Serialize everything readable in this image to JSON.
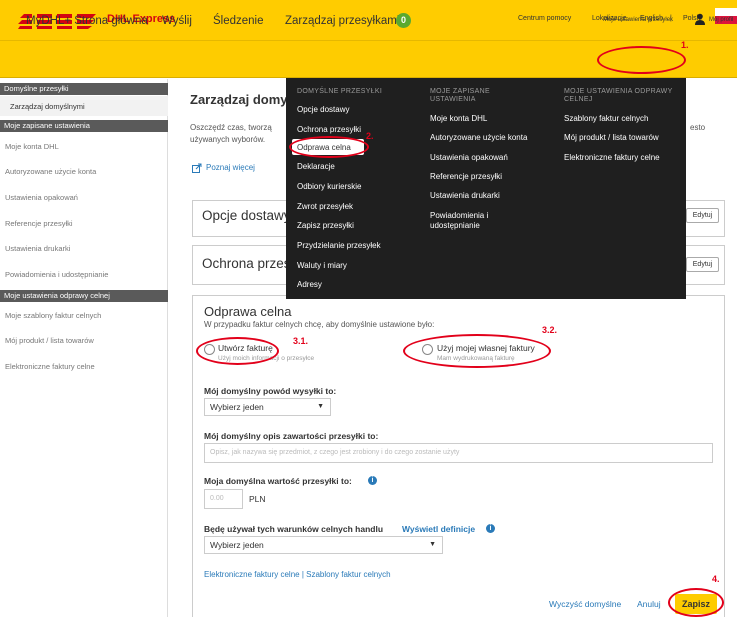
{
  "header": {
    "brand": "DHL Express",
    "links": [
      "Centrum pomocy",
      "Lokalizacje",
      "English",
      "|",
      "Polski"
    ]
  },
  "nav": {
    "items": [
      "MyDHL+ Strona główna",
      "Wyślij",
      "Śledzenie",
      "Zarządzaj przesyłkami"
    ],
    "badge": "0",
    "settings": "Moje ustawienia przesyłek",
    "profile": "Mój profil"
  },
  "sidebar": {
    "sections": [
      {
        "header": "Domyślne przesyłki",
        "items": [
          "Zarządzaj domyślnymi"
        ]
      },
      {
        "header": "Moje zapisane ustawienia",
        "items": [
          "Moje konta DHL",
          "Autoryzowane użycie konta",
          "Ustawienia opakowań",
          "Referencje przesyłki",
          "Ustawienia drukarki",
          "Powiadomienia i udostępnianie"
        ]
      },
      {
        "header": "Moje ustawienia odprawy celnej",
        "items": [
          "Moje szablony faktur celnych",
          "Mój produkt / lista towarów",
          "Elektroniczne faktury celne"
        ]
      }
    ]
  },
  "main": {
    "title": "Zarządzaj domyś",
    "description_line1": "Oszczędź czas, tworzą",
    "description_line1_end": "esto",
    "description_line2": "używanych wyborów.",
    "learn_more": "Poznaj więcej",
    "panels": [
      {
        "title": "Opcje dostawy",
        "edit": "Edytuj"
      },
      {
        "title": "Ochrona przes",
        "edit": "Edytuj"
      }
    ]
  },
  "customs": {
    "title": "Odprawa celna",
    "subtitle": "W przypadku faktur celnych chcę, aby domyślnie ustawione było:",
    "option1_label": "Utwórz fakturę",
    "option1_sub": "Użyj moich informacji o przesyłce",
    "option2_label": "Użyj mojej własnej faktury",
    "option2_sub": "Mam wydrukowaną fakturę",
    "reason_label": "Mój domyślny powód wysyłki to:",
    "reason_value": "Wybierz jeden",
    "desc_label": "Mój domyślny opis zawartości przesyłki to:",
    "desc_placeholder": "Opisz, jak nazywa się przedmiot, z czego jest zrobiony i do czego zostanie użyty",
    "value_label": "Moja domyślna wartość przesyłki to:",
    "value_placeholder": "0.00",
    "currency": "PLN",
    "terms_label": "Będę używał tych warunków celnych handlu",
    "terms_link": "Wyświetl definicje",
    "terms_value": "Wybierz jeden",
    "links_line": "Elektroniczne faktury celne | Szablony faktur celnych",
    "clear": "Wyczyść domyślne",
    "cancel": "Anuluj",
    "save": "Zapisz"
  },
  "mega_menu": {
    "col1_head": "DOMYŚLNE PRZESYŁKI",
    "col1": [
      "Opcje dostawy",
      "Ochrona przesyłki",
      "Odprawa celna",
      "Deklaracje",
      "Odbiory kurierskie",
      "Zwrot przesyłek",
      "Zapisz przesyłki",
      "Przydzielanie przesyłek",
      "Waluty i miary",
      "Adresy"
    ],
    "col2_head": "MOJE ZAPISANE USTAWIENIA",
    "col2": [
      "Moje konta DHL",
      "Autoryzowane użycie konta",
      "Ustawienia opakowań",
      "Referencje przesyłki",
      "Ustawienia drukarki",
      "Powiadomienia i udostępnianie"
    ],
    "col3_head": "MOJE USTAWIENIA ODPRAWY CELNEJ",
    "col3": [
      "Szablony faktur celnych",
      "Mój produkt / lista towarów",
      "Elektroniczne faktury celne"
    ]
  },
  "annotations": [
    "1.",
    "2.",
    "3.1.",
    "3.2.",
    "4."
  ],
  "colors": {
    "dhl_yellow": "#ffcc00",
    "dhl_red": "#d40511",
    "annotation_red": "#e2001a",
    "menu_bg": "#1f1f1f"
  }
}
